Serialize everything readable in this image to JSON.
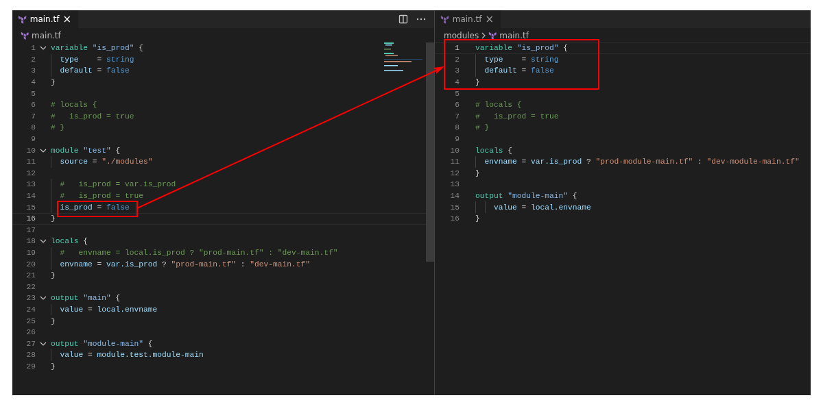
{
  "panes": [
    {
      "focused": true,
      "tab": {
        "label": "main.tf",
        "close": "×"
      },
      "actions": [
        {
          "kind": "split"
        },
        {
          "kind": "more"
        }
      ],
      "breadcrumb": [
        {
          "kind": "file",
          "label": "main.tf"
        }
      ],
      "lines": [
        {
          "number": "1",
          "foldable": true,
          "current": false,
          "tokens": [
            {
              "kind": "keyword",
              "text": "variable "
            },
            {
              "kind": "label",
              "text": "\"is_prod\""
            },
            {
              "kind": "plain",
              "text": " {"
            }
          ]
        },
        {
          "number": "2",
          "foldable": false,
          "current": false,
          "tokens": [
            {
              "kind": "prop",
              "text": "  type"
            },
            {
              "kind": "plain",
              "text": "    = "
            },
            {
              "kind": "value",
              "text": "string"
            }
          ]
        },
        {
          "number": "3",
          "foldable": false,
          "current": false,
          "tokens": [
            {
              "kind": "prop",
              "text": "  default"
            },
            {
              "kind": "plain",
              "text": " = "
            },
            {
              "kind": "value",
              "text": "false"
            }
          ]
        },
        {
          "number": "4",
          "foldable": false,
          "current": false,
          "tokens": [
            {
              "kind": "plain",
              "text": "}"
            }
          ]
        },
        {
          "number": "5",
          "foldable": false,
          "current": false
        },
        {
          "number": "6",
          "foldable": false,
          "current": false,
          "tokens": [
            {
              "kind": "comment",
              "text": "# locals {"
            }
          ]
        },
        {
          "number": "7",
          "foldable": false,
          "current": false,
          "tokens": [
            {
              "kind": "comment",
              "text": "#   is_prod = true"
            }
          ]
        },
        {
          "number": "8",
          "foldable": false,
          "current": false,
          "tokens": [
            {
              "kind": "comment",
              "text": "# }"
            }
          ]
        },
        {
          "number": "9",
          "foldable": false,
          "current": false
        },
        {
          "number": "10",
          "foldable": true,
          "current": false,
          "tokens": [
            {
              "kind": "keyword",
              "text": "module "
            },
            {
              "kind": "label",
              "text": "\"test\""
            },
            {
              "kind": "plain",
              "text": " {"
            }
          ]
        },
        {
          "number": "11",
          "foldable": false,
          "current": false,
          "tokens": [
            {
              "kind": "prop",
              "text": "  source"
            },
            {
              "kind": "plain",
              "text": " = "
            },
            {
              "kind": "string",
              "text": "\"./modules\""
            }
          ]
        },
        {
          "number": "12",
          "foldable": false,
          "current": false
        },
        {
          "number": "13",
          "foldable": false,
          "current": false,
          "tokens": [
            {
              "kind": "comment",
              "text": "  #   is_prod = var.is_prod"
            }
          ]
        },
        {
          "number": "14",
          "foldable": false,
          "current": false,
          "tokens": [
            {
              "kind": "comment",
              "text": "  #   is_prod = true"
            }
          ]
        },
        {
          "number": "15",
          "foldable": false,
          "current": false,
          "tokens": [
            {
              "kind": "prop",
              "text": "  is_prod"
            },
            {
              "kind": "plain",
              "text": " = "
            },
            {
              "kind": "value",
              "text": "false"
            }
          ]
        },
        {
          "number": "16",
          "foldable": false,
          "current": true,
          "tokens": [
            {
              "kind": "plain",
              "text": "}"
            }
          ]
        },
        {
          "number": "17",
          "foldable": false,
          "current": false
        },
        {
          "number": "18",
          "foldable": true,
          "current": false,
          "tokens": [
            {
              "kind": "keyword",
              "text": "locals"
            },
            {
              "kind": "plain",
              "text": " {"
            }
          ]
        },
        {
          "number": "19",
          "foldable": false,
          "current": false,
          "tokens": [
            {
              "kind": "comment",
              "text": "  #   envname = local.is_prod ? \"prod-main.tf\" : \"dev-main.tf\""
            }
          ]
        },
        {
          "number": "20",
          "foldable": false,
          "current": false,
          "tokens": [
            {
              "kind": "prop",
              "text": "  envname"
            },
            {
              "kind": "plain",
              "text": " = "
            },
            {
              "kind": "prop",
              "text": "var.is_prod"
            },
            {
              "kind": "plain",
              "text": " ? "
            },
            {
              "kind": "string",
              "text": "\"prod-main.tf\""
            },
            {
              "kind": "plain",
              "text": " : "
            },
            {
              "kind": "string",
              "text": "\"dev-main.tf\""
            }
          ]
        },
        {
          "number": "21",
          "foldable": false,
          "current": false,
          "tokens": [
            {
              "kind": "plain",
              "text": "}"
            }
          ]
        },
        {
          "number": "22",
          "foldable": false,
          "current": false
        },
        {
          "number": "23",
          "foldable": true,
          "current": false,
          "tokens": [
            {
              "kind": "keyword",
              "text": "output "
            },
            {
              "kind": "label",
              "text": "\"main\""
            },
            {
              "kind": "plain",
              "text": " {"
            }
          ]
        },
        {
          "number": "24",
          "foldable": false,
          "current": false,
          "tokens": [
            {
              "kind": "prop",
              "text": "  value"
            },
            {
              "kind": "plain",
              "text": " = "
            },
            {
              "kind": "prop",
              "text": "local.envname"
            }
          ]
        },
        {
          "number": "25",
          "foldable": false,
          "current": false,
          "tokens": [
            {
              "kind": "plain",
              "text": "}"
            }
          ]
        },
        {
          "number": "26",
          "foldable": false,
          "current": false
        },
        {
          "number": "27",
          "foldable": true,
          "current": false,
          "tokens": [
            {
              "kind": "keyword",
              "text": "output "
            },
            {
              "kind": "label",
              "text": "\"module-main\""
            },
            {
              "kind": "plain",
              "text": " {"
            }
          ]
        },
        {
          "number": "28",
          "foldable": false,
          "current": false,
          "tokens": [
            {
              "kind": "prop",
              "text": "  value"
            },
            {
              "kind": "plain",
              "text": " = "
            },
            {
              "kind": "prop",
              "text": "module.test.module-main"
            }
          ]
        },
        {
          "number": "29",
          "foldable": false,
          "current": false,
          "tokens": [
            {
              "kind": "plain",
              "text": "}"
            }
          ]
        }
      ]
    },
    {
      "focused": false,
      "tab": {
        "label": "main.tf",
        "close": "×"
      },
      "breadcrumb": [
        {
          "kind": "folder",
          "label": "modules"
        },
        {
          "kind": "file",
          "label": "main.tf"
        }
      ],
      "lines": [
        {
          "number": "1",
          "foldable": false,
          "current": true,
          "tokens": [
            {
              "kind": "keyword",
              "text": "variable "
            },
            {
              "kind": "label",
              "text": "\"is_prod\""
            },
            {
              "kind": "plain",
              "text": " {"
            }
          ]
        },
        {
          "number": "2",
          "foldable": false,
          "current": false,
          "tokens": [
            {
              "kind": "prop",
              "text": "  type"
            },
            {
              "kind": "plain",
              "text": "    = "
            },
            {
              "kind": "value",
              "text": "string"
            }
          ]
        },
        {
          "number": "3",
          "foldable": false,
          "current": false,
          "tokens": [
            {
              "kind": "prop",
              "text": "  default"
            },
            {
              "kind": "plain",
              "text": " = "
            },
            {
              "kind": "value",
              "text": "false"
            }
          ]
        },
        {
          "number": "4",
          "foldable": false,
          "current": false,
          "tokens": [
            {
              "kind": "plain",
              "text": "}"
            }
          ]
        },
        {
          "number": "5",
          "foldable": false,
          "current": false
        },
        {
          "number": "6",
          "foldable": false,
          "current": false,
          "tokens": [
            {
              "kind": "comment",
              "text": "# locals {"
            }
          ]
        },
        {
          "number": "7",
          "foldable": false,
          "current": false,
          "tokens": [
            {
              "kind": "comment",
              "text": "#   is_prod = true"
            }
          ]
        },
        {
          "number": "8",
          "foldable": false,
          "current": false,
          "tokens": [
            {
              "kind": "comment",
              "text": "# }"
            }
          ]
        },
        {
          "number": "9",
          "foldable": false,
          "current": false
        },
        {
          "number": "10",
          "foldable": false,
          "current": false,
          "tokens": [
            {
              "kind": "keyword",
              "text": "locals"
            },
            {
              "kind": "plain",
              "text": " {"
            }
          ]
        },
        {
          "number": "11",
          "foldable": false,
          "current": false,
          "tokens": [
            {
              "kind": "prop",
              "text": "  envname"
            },
            {
              "kind": "plain",
              "text": " = "
            },
            {
              "kind": "prop",
              "text": "var.is_prod"
            },
            {
              "kind": "plain",
              "text": " ? "
            },
            {
              "kind": "string",
              "text": "\"prod-module-main.tf\""
            },
            {
              "kind": "plain",
              "text": " : "
            },
            {
              "kind": "string",
              "text": "\"dev-module-main.tf\""
            }
          ]
        },
        {
          "number": "12",
          "foldable": false,
          "current": false,
          "tokens": [
            {
              "kind": "plain",
              "text": "}"
            }
          ]
        },
        {
          "number": "13",
          "foldable": false,
          "current": false
        },
        {
          "number": "14",
          "foldable": false,
          "current": false,
          "tokens": [
            {
              "kind": "keyword",
              "text": "output "
            },
            {
              "kind": "label",
              "text": "\"module-main\""
            },
            {
              "kind": "plain",
              "text": " {"
            }
          ]
        },
        {
          "number": "15",
          "foldable": false,
          "current": false,
          "tokens": [
            {
              "kind": "prop",
              "text": "    value"
            },
            {
              "kind": "plain",
              "text": " = "
            },
            {
              "kind": "prop",
              "text": "local.envname"
            }
          ]
        },
        {
          "number": "16",
          "foldable": false,
          "current": false,
          "tokens": [
            {
              "kind": "plain",
              "text": "}"
            }
          ]
        }
      ]
    }
  ]
}
